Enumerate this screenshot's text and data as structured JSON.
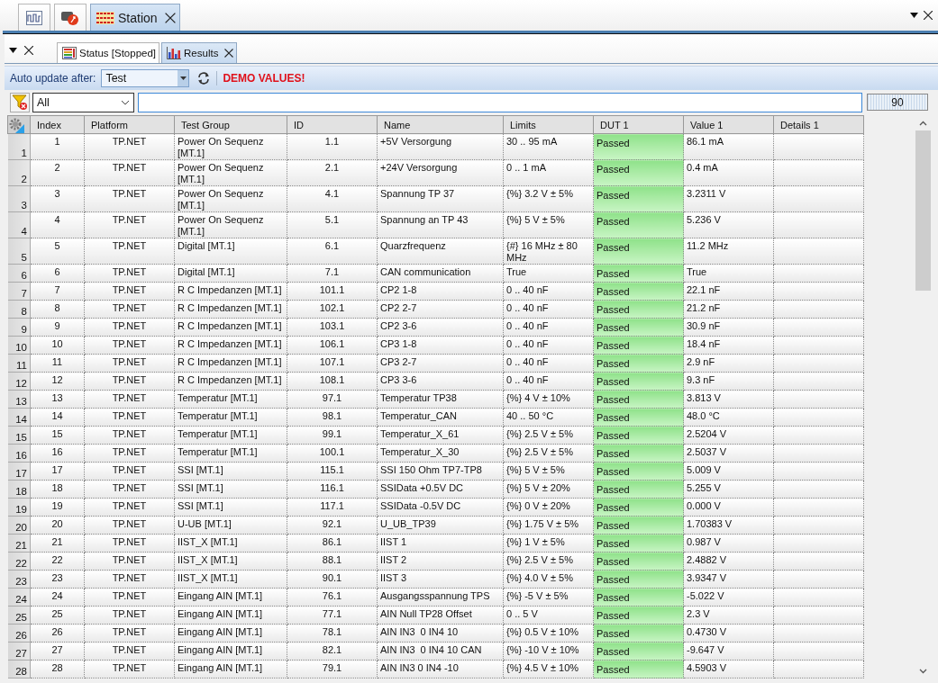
{
  "top_tabs": [
    {
      "kind": "wave",
      "selected": false
    },
    {
      "kind": "device",
      "selected": false
    },
    {
      "kind": "station",
      "label": "Station",
      "selected": true
    }
  ],
  "panel_tabs": [
    {
      "kind": "status",
      "label": "Status [Stopped]",
      "selected": false
    },
    {
      "kind": "results",
      "label": "Results",
      "selected": true
    }
  ],
  "toolbar": {
    "label": "Auto update after:",
    "combo_value": "Test",
    "warning": "DEMO VALUES!"
  },
  "filter": {
    "value": "All",
    "count": "90"
  },
  "table": {
    "columns": [
      "Index",
      "Platform",
      "Test Group",
      "ID",
      "Name",
      "Limits",
      "DUT 1",
      "Value 1",
      "Details 1"
    ],
    "rows": [
      {
        "row": "1",
        "cells": [
          "1",
          "TP.NET",
          "Power On Sequenz [MT.1]",
          "1.1",
          "+5V Versorgung",
          "30 .. 95 mA",
          "Passed",
          "86.1 mA"
        ],
        "passed": true
      },
      {
        "row": "2",
        "cells": [
          "2",
          "TP.NET",
          "Power On Sequenz [MT.1]",
          "2.1",
          "+24V Versorgung",
          "0 .. 1 mA",
          "Passed",
          "0.4 mA"
        ],
        "passed": true
      },
      {
        "row": "3",
        "cells": [
          "3",
          "TP.NET",
          "Power On Sequenz [MT.1]",
          "4.1",
          "Spannung TP 37",
          "{%} 3.2 V ± 5%",
          "Passed",
          "3.2311 V"
        ],
        "passed": true
      },
      {
        "row": "4",
        "cells": [
          "4",
          "TP.NET",
          "Power On Sequenz [MT.1]",
          "5.1",
          "Spannung an TP 43",
          "{%} 5 V ± 5%",
          "Passed",
          "5.236 V"
        ],
        "passed": true
      },
      {
        "row": "5",
        "cells": [
          "5",
          "TP.NET",
          "Digital [MT.1]",
          "6.1",
          "Quarzfrequenz",
          "{#} 16 MHz ± 80 MHz",
          "Passed",
          "11.2 MHz"
        ],
        "passed": true
      },
      {
        "row": "6",
        "cells": [
          "6",
          "TP.NET",
          "Digital [MT.1]",
          "7.1",
          "CAN communication",
          "True",
          "Passed",
          "True"
        ],
        "passed": true
      },
      {
        "row": "7",
        "cells": [
          "7",
          "TP.NET",
          "R C Impedanzen [MT.1]",
          "101.1",
          "CP2 1-8",
          "0 .. 40 nF",
          "Passed",
          "22.1 nF"
        ],
        "passed": true
      },
      {
        "row": "8",
        "cells": [
          "8",
          "TP.NET",
          "R C Impedanzen [MT.1]",
          "102.1",
          "CP2 2-7",
          "0 .. 40 nF",
          "Passed",
          "21.2 nF"
        ],
        "passed": true
      },
      {
        "row": "9",
        "cells": [
          "9",
          "TP.NET",
          "R C Impedanzen [MT.1]",
          "103.1",
          "CP2 3-6",
          "0 .. 40 nF",
          "Passed",
          "30.9 nF"
        ],
        "passed": true
      },
      {
        "row": "10",
        "cells": [
          "10",
          "TP.NET",
          "R C Impedanzen [MT.1]",
          "106.1",
          "CP3 1-8",
          "0 .. 40 nF",
          "Passed",
          "18.4 nF"
        ],
        "passed": true
      },
      {
        "row": "11",
        "cells": [
          "11",
          "TP.NET",
          "R C Impedanzen [MT.1]",
          "107.1",
          "CP3 2-7",
          "0 .. 40 nF",
          "Passed",
          "2.9 nF"
        ],
        "passed": true
      },
      {
        "row": "12",
        "cells": [
          "12",
          "TP.NET",
          "R C Impedanzen [MT.1]",
          "108.1",
          "CP3 3-6",
          "0 .. 40 nF",
          "Passed",
          "9.3 nF"
        ],
        "passed": true
      },
      {
        "row": "13",
        "cells": [
          "13",
          "TP.NET",
          "Temperatur [MT.1]",
          "97.1",
          "Temperatur TP38",
          "{%} 4 V ± 10%",
          "Passed",
          "3.813 V"
        ],
        "passed": true
      },
      {
        "row": "14",
        "cells": [
          "14",
          "TP.NET",
          "Temperatur [MT.1]",
          "98.1",
          "Temperatur_CAN",
          "40 .. 50 °C",
          "Passed",
          "48.0 °C"
        ],
        "passed": true
      },
      {
        "row": "15",
        "cells": [
          "15",
          "TP.NET",
          "Temperatur [MT.1]",
          "99.1",
          "Temperatur_X_61",
          "{%} 2.5 V ± 5%",
          "Passed",
          "2.5204 V"
        ],
        "passed": true
      },
      {
        "row": "16",
        "cells": [
          "16",
          "TP.NET",
          "Temperatur [MT.1]",
          "100.1",
          "Temperatur_X_30",
          "{%} 2.5 V ± 5%",
          "Passed",
          "2.5037 V"
        ],
        "passed": true
      },
      {
        "row": "17",
        "cells": [
          "17",
          "TP.NET",
          "SSI [MT.1]",
          "115.1",
          "SSI 150 Ohm TP7-TP8",
          "{%} 5 V ± 5%",
          "Passed",
          "5.009 V"
        ],
        "passed": true
      },
      {
        "row": "18",
        "cells": [
          "18",
          "TP.NET",
          "SSI [MT.1]",
          "116.1",
          "SSIData +0.5V DC",
          "{%} 5 V ± 20%",
          "Passed",
          "5.255 V"
        ],
        "passed": true
      },
      {
        "row": "19",
        "cells": [
          "19",
          "TP.NET",
          "SSI [MT.1]",
          "117.1",
          "SSIData -0.5V DC",
          "{%} 0 V ± 20%",
          "Passed",
          "0.000 V"
        ],
        "passed": true
      },
      {
        "row": "20",
        "cells": [
          "20",
          "TP.NET",
          "U-UB [MT.1]",
          "92.1",
          "U_UB_TP39",
          "{%} 1.75 V ± 5%",
          "Passed",
          "1.70383 V"
        ],
        "passed": true
      },
      {
        "row": "21",
        "cells": [
          "21",
          "TP.NET",
          "IIST_X [MT.1]",
          "86.1",
          "IIST 1",
          "{%} 1 V ± 5%",
          "Passed",
          "0.987 V"
        ],
        "passed": true
      },
      {
        "row": "22",
        "cells": [
          "22",
          "TP.NET",
          "IIST_X [MT.1]",
          "88.1",
          "IIST 2",
          "{%} 2.5 V ± 5%",
          "Passed",
          "2.4882 V"
        ],
        "passed": true
      },
      {
        "row": "23",
        "cells": [
          "23",
          "TP.NET",
          "IIST_X [MT.1]",
          "90.1",
          "IIST 3",
          "{%} 4.0 V ± 5%",
          "Passed",
          "3.9347 V"
        ],
        "passed": true
      },
      {
        "row": "24",
        "cells": [
          "24",
          "TP.NET",
          "Eingang AIN [MT.1]",
          "76.1",
          "Ausgangsspannung TPS",
          "{%} -5 V ± 5%",
          "Passed",
          "-5.022 V"
        ],
        "passed": true
      },
      {
        "row": "25",
        "cells": [
          "25",
          "TP.NET",
          "Eingang AIN [MT.1]",
          "77.1",
          "AIN Null TP28 Offset",
          "0 .. 5 V",
          "Passed",
          "2.3 V"
        ],
        "passed": true
      },
      {
        "row": "26",
        "cells": [
          "26",
          "TP.NET",
          "Eingang AIN [MT.1]",
          "78.1",
          "AIN IN3  0 IN4 10",
          "{%} 0.5 V ± 10%",
          "Passed",
          "0.4730 V"
        ],
        "passed": true
      },
      {
        "row": "27",
        "cells": [
          "27",
          "TP.NET",
          "Eingang AIN [MT.1]",
          "82.1",
          "AIN IN3  0 IN4 10 CAN",
          "{%} -10 V ± 10%",
          "Passed",
          "-9.647 V"
        ],
        "passed": true
      },
      {
        "row": "28",
        "cells": [
          "28",
          "TP.NET",
          "Eingang AIN [MT.1]",
          "79.1",
          "AIN IN3 0 IN4 -10",
          "{%} 4.5 V ± 10%",
          "Passed",
          "4.5903 V"
        ],
        "passed": true
      }
    ]
  }
}
